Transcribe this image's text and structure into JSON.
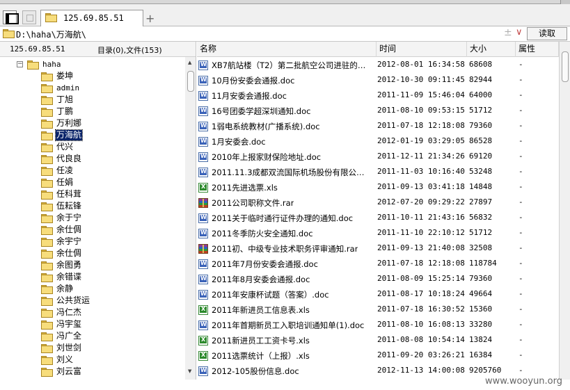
{
  "tab": {
    "title": "125.69.85.51"
  },
  "address": {
    "path": "D:\\haha\\万海航\\",
    "plus": "±",
    "chevron": "∨",
    "go_label": "读取"
  },
  "left_panel": {
    "host": "125.69.85.51",
    "count_text": "目录(0),文件(153)",
    "root": {
      "expander": "−",
      "label": "haha"
    },
    "folders": [
      "娄坤",
      "admin",
      "丁旭",
      "丁鹏",
      "万利娜",
      "万海航",
      "代兴",
      "代良良",
      "任凌",
      "任娟",
      "任科茸",
      "伍耘锋",
      "余于宁",
      "余仕倜",
      "余宇宁",
      "余仕倜",
      "余图勇",
      "余错谍",
      "余静",
      "公共货运",
      "冯仁杰",
      "冯宇玺",
      "冯广全",
      "刘世剑",
      "刘义",
      "刘云富"
    ],
    "selected_folder": "万海航"
  },
  "file_list": {
    "columns": {
      "name": "名称",
      "time": "时间",
      "size": "大小",
      "attr": "属性"
    },
    "rows": [
      {
        "icon": "doc",
        "name": "XB7航站楼（T2）第二批航空公司进驻的…",
        "time": "2012-08-01 16:34:58",
        "size": "68608",
        "attr": "-"
      },
      {
        "icon": "doc",
        "name": "10月份安委会通报.doc",
        "time": "2012-10-30 09:11:45",
        "size": "82944",
        "attr": "-"
      },
      {
        "icon": "doc",
        "name": "11月安委会通报.doc",
        "time": "2011-11-09 15:46:04",
        "size": "64000",
        "attr": "-"
      },
      {
        "icon": "doc",
        "name": "16号团委学超深圳通知.doc",
        "time": "2011-08-10 09:53:15",
        "size": "51712",
        "attr": "-"
      },
      {
        "icon": "doc",
        "name": "1弱电系统教材(广播系统).doc",
        "time": "2011-07-18 12:18:08",
        "size": "79360",
        "attr": "-"
      },
      {
        "icon": "doc",
        "name": "1月安委会.doc",
        "time": "2012-01-19 03:29:05",
        "size": "86528",
        "attr": "-"
      },
      {
        "icon": "doc",
        "name": "2010年上报家财保险地址.doc",
        "time": "2011-12-11 21:34:26",
        "size": "69120",
        "attr": "-"
      },
      {
        "icon": "doc",
        "name": "2011.11.3成都双流国际机场股份有限公…",
        "time": "2011-11-03 10:16:40",
        "size": "53248",
        "attr": "-"
      },
      {
        "icon": "xls",
        "name": "2011先进选票.xls",
        "time": "2011-09-13 03:41:18",
        "size": "14848",
        "attr": "-"
      },
      {
        "icon": "rar",
        "name": "2011公司职称文件.rar",
        "time": "2012-07-20 09:29:22",
        "size": "27897",
        "attr": "-"
      },
      {
        "icon": "doc",
        "name": "2011关于临时通行证件办理的通知.doc",
        "time": "2011-10-11 21:43:16",
        "size": "56832",
        "attr": "-"
      },
      {
        "icon": "doc",
        "name": "2011冬季防火安全通知.doc",
        "time": "2011-11-10 22:10:12",
        "size": "51712",
        "attr": "-"
      },
      {
        "icon": "rar",
        "name": "2011初、中级专业技术职务评审通知.rar",
        "time": "2011-09-13 21:40:08",
        "size": "32508",
        "attr": "-"
      },
      {
        "icon": "doc",
        "name": "2011年7月份安委会通报.doc",
        "time": "2011-07-18 12:18:08",
        "size": "118784",
        "attr": "-"
      },
      {
        "icon": "doc",
        "name": "2011年8月安委会通报.doc",
        "time": "2011-08-09 15:25:14",
        "size": "79360",
        "attr": "-"
      },
      {
        "icon": "doc",
        "name": "2011年安康杯试题（答案）.doc",
        "time": "2011-08-17 10:18:24",
        "size": "49664",
        "attr": "-"
      },
      {
        "icon": "xls",
        "name": "2011年新进员工信息表.xls",
        "time": "2011-07-18 16:30:52",
        "size": "15360",
        "attr": "-"
      },
      {
        "icon": "doc",
        "name": "2011年首期新员工入职培训通知单(1).doc",
        "time": "2011-08-10 16:08:13",
        "size": "33280",
        "attr": "-"
      },
      {
        "icon": "xls",
        "name": "2011新进员工工资卡号.xls",
        "time": "2011-08-08 10:54:14",
        "size": "13824",
        "attr": "-"
      },
      {
        "icon": "xls",
        "name": "2011选票统计（上报）.xls",
        "time": "2011-09-20 03:26:21",
        "size": "16384",
        "attr": "-"
      },
      {
        "icon": "doc",
        "name": "2012-105股份信息.doc",
        "time": "2012-11-13 14:00:08",
        "size": "9205760",
        "attr": "-"
      }
    ]
  },
  "watermark": "www.wooyun.org"
}
